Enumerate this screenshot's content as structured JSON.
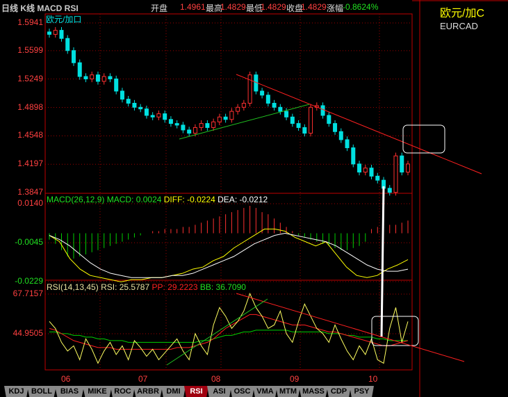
{
  "header": {
    "title": "日线 K线 MACD RSI",
    "open_label": "开盘",
    "open": "1.4961",
    "high_label": "最高",
    "high": "1.4829",
    "low_label": "最低",
    "low": "1.4829",
    "close_label": "收盘",
    "close": "1.4829",
    "change_label": "涨幅",
    "change": "-0.8624%"
  },
  "side": {
    "name_cn": "欧元/加C",
    "code": "EURCAD"
  },
  "price_panel": {
    "label": "欧元/加口",
    "ticks": [
      "1.5941",
      "1.5599",
      "1.5249",
      "1.4898",
      "1.4548",
      "1.4197",
      "1.3847"
    ]
  },
  "macd_panel": {
    "label": "MACD(26,12,9)",
    "macd": "MACD: 0.0024",
    "diff": "DIFF: -0.0224",
    "dea": "DEA: -0.0212",
    "ticks": [
      "0.0140",
      "-0.0045",
      "-0.0229"
    ]
  },
  "rsi_panel": {
    "label": "RSI(14,13,45)",
    "rsi": "RSI: 25.5787",
    "pp": "PP: 29.2223",
    "bb": "BB: 36.7090",
    "ticks": [
      "67.7157",
      "44.9505"
    ]
  },
  "x_labels": [
    "06",
    "07",
    "08",
    "09",
    "10"
  ],
  "tabs": [
    "KDJ",
    "BOLL",
    "BIAS",
    "MIKE",
    "ROC",
    "ARBR",
    "DMI",
    "RSI",
    "ASI",
    "OSC",
    "VMA",
    "MTM",
    "MASS",
    "CDP",
    "PSY"
  ],
  "active_tab": "RSI",
  "colors": {
    "up": "#ff3030",
    "down": "#00e0e0",
    "frame": "#c00000",
    "diff": "#ffff00",
    "dea": "#ffffff",
    "pp": "#ff2020",
    "bb": "#00d000"
  },
  "chart_data": {
    "type": "candlestick",
    "closes": [
      1.58,
      1.585,
      1.575,
      1.56,
      1.545,
      1.528,
      1.525,
      1.53,
      1.522,
      1.528,
      1.525,
      1.51,
      1.5,
      1.495,
      1.49,
      1.488,
      1.48,
      1.478,
      1.482,
      1.475,
      1.47,
      1.468,
      1.462,
      1.458,
      1.465,
      1.47,
      1.465,
      1.472,
      1.478,
      1.475,
      1.485,
      1.49,
      1.495,
      1.53,
      1.51,
      1.505,
      1.495,
      1.49,
      1.485,
      1.478,
      1.47,
      1.465,
      1.458,
      1.49,
      1.492,
      1.48,
      1.47,
      1.46,
      1.45,
      1.44,
      1.42,
      1.41,
      1.415,
      1.405,
      1.4,
      1.39,
      1.385,
      1.43,
      1.41,
      1.42
    ],
    "price_range": [
      1.3847,
      1.5941
    ],
    "macd_hist": [
      -0.003,
      -0.005,
      -0.008,
      -0.011,
      -0.012,
      -0.011,
      -0.01,
      -0.009,
      -0.008,
      -0.007,
      -0.006,
      -0.005,
      -0.004,
      -0.003,
      -0.002,
      -0.001,
      0,
      0.001,
      0.001,
      0.002,
      0.002,
      0.002,
      0.003,
      0.003,
      0.004,
      0.005,
      0.006,
      0.007,
      0.008,
      0.009,
      0.01,
      0.011,
      0.012,
      0.013,
      0.012,
      0.01,
      0.009,
      0.007,
      0.005,
      0.003,
      0.001,
      -0.001,
      -0.002,
      -0.003,
      -0.004,
      -0.005,
      -0.006,
      -0.007,
      -0.008,
      -0.008,
      -0.007,
      -0.006,
      -0.004,
      0.002,
      0.003,
      0.004,
      0.004,
      0.004,
      0.005,
      0.006
    ],
    "diff": [
      -0.001,
      -0.004,
      -0.012,
      -0.017,
      -0.02,
      -0.021,
      -0.022,
      -0.023,
      -0.022,
      -0.022,
      -0.021,
      -0.021,
      -0.02,
      -0.019,
      -0.017,
      -0.016,
      -0.013,
      -0.011,
      -0.007,
      -0.004,
      -0.001,
      0.002,
      0.002,
      0.001,
      -0.002,
      -0.004,
      -0.006,
      -0.004,
      -0.01,
      -0.016,
      -0.02,
      -0.021,
      -0.02,
      -0.017,
      -0.015,
      -0.0125
    ],
    "dea": [
      -0.001,
      -0.003,
      -0.006,
      -0.01,
      -0.014,
      -0.017,
      -0.019,
      -0.02,
      -0.021,
      -0.021,
      -0.021,
      -0.021,
      -0.02,
      -0.02,
      -0.019,
      -0.017,
      -0.015,
      -0.013,
      -0.011,
      -0.008,
      -0.005,
      -0.003,
      -0.001,
      0.0,
      -0.001,
      -0.002,
      -0.003,
      -0.004,
      -0.006,
      -0.009,
      -0.012,
      -0.015,
      -0.017,
      -0.018,
      -0.018,
      -0.017
    ],
    "macd_range": [
      -0.0229,
      0.014
    ],
    "rsi": [
      52,
      48,
      40,
      35,
      38,
      30,
      42,
      36,
      28,
      35,
      40,
      33,
      38,
      30,
      41,
      37,
      32,
      36,
      30,
      34,
      38,
      42,
      35,
      30,
      45,
      38,
      33,
      50,
      60,
      55,
      48,
      52,
      58,
      68,
      60,
      55,
      48,
      50,
      58,
      45,
      40,
      52,
      62,
      55,
      48,
      45,
      40,
      50,
      42,
      35,
      30,
      38,
      33,
      42,
      30,
      28,
      48,
      60,
      40,
      52
    ],
    "pp": [
      48,
      47,
      45,
      43,
      41,
      40,
      39,
      38,
      37,
      37,
      37,
      36,
      36,
      36,
      36,
      36,
      36,
      36,
      36,
      36,
      36,
      37,
      37,
      37,
      38,
      39,
      40,
      42,
      45,
      48,
      50,
      52,
      54,
      56,
      56,
      55,
      54,
      53,
      52,
      51,
      50,
      50,
      50,
      49,
      48,
      47,
      46,
      46,
      45,
      44,
      43,
      42,
      41,
      40,
      39,
      38,
      38,
      39,
      40,
      41
    ],
    "bb": [
      46,
      46,
      45,
      45,
      44,
      44,
      43,
      43,
      42,
      42,
      41,
      41,
      41,
      40,
      40,
      40,
      40,
      40,
      40,
      40,
      40,
      40,
      40,
      40,
      40,
      41,
      41,
      42,
      43,
      44,
      44,
      45,
      46,
      46,
      47,
      47,
      47,
      47,
      47,
      47,
      46,
      46,
      46,
      46,
      46,
      46,
      45,
      45,
      45,
      44,
      44,
      43,
      43,
      43,
      42,
      42,
      41,
      41,
      41,
      41
    ],
    "rsi_range": [
      28,
      68
    ]
  }
}
